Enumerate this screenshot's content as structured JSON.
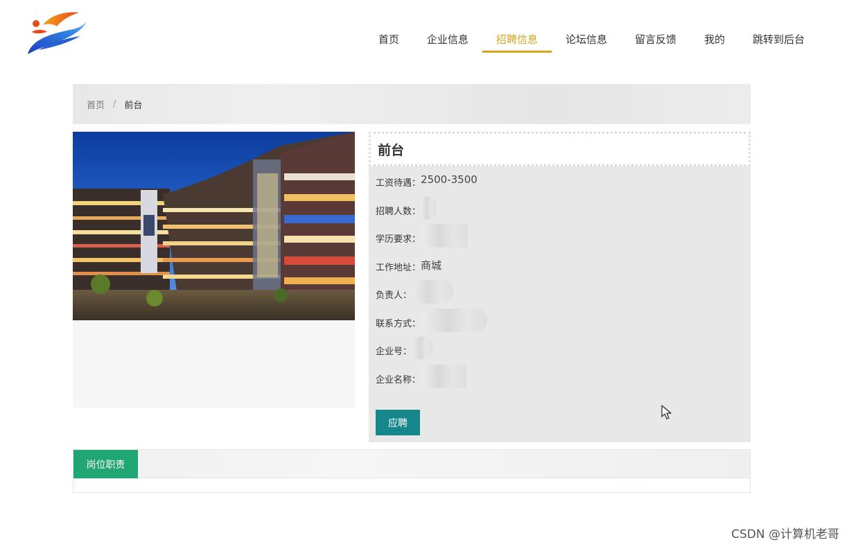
{
  "nav": {
    "items": [
      {
        "label": "首页",
        "active": false
      },
      {
        "label": "企业信息",
        "active": false
      },
      {
        "label": "招聘信息",
        "active": true
      },
      {
        "label": "论坛信息",
        "active": false
      },
      {
        "label": "留言反馈",
        "active": false
      },
      {
        "label": "我的",
        "active": false
      },
      {
        "label": "跳转到后台",
        "active": false
      }
    ]
  },
  "breadcrumb": {
    "home": "首页",
    "separator": "/",
    "current": "前台"
  },
  "job": {
    "title": "前台",
    "fields": [
      {
        "label": "工资待遇：",
        "value": "2500-3500"
      },
      {
        "label": "招聘人数：",
        "value": ""
      },
      {
        "label": "学历要求：",
        "value": ""
      },
      {
        "label": "工作地址：",
        "value": "商城"
      },
      {
        "label": "负责人：",
        "value": ""
      },
      {
        "label": "联系方式：",
        "value": ""
      },
      {
        "label": "企业号：",
        "value": ""
      },
      {
        "label": "企业名称：",
        "value": ""
      }
    ],
    "apply_label": "应聘"
  },
  "tabs": {
    "active_label": "岗位职责"
  },
  "watermark": "CSDN @计算机老哥",
  "colors": {
    "accent": "#d9a31a",
    "apply_button": "#16878a",
    "tab_active": "#1fa672"
  }
}
